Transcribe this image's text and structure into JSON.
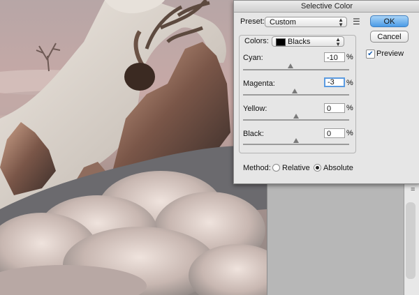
{
  "dialog": {
    "title": "Selective Color",
    "preset_label": "Preset:",
    "preset_value": "Custom",
    "preset_menu_icon": "list-menu-icon",
    "colors_label": "Colors:",
    "colors_value": "Blacks",
    "colors_swatch": "#000000",
    "ok_label": "OK",
    "cancel_label": "Cancel",
    "preview_label": "Preview",
    "preview_checked": true,
    "sliders": [
      {
        "label": "Cyan:",
        "value": "-10",
        "unit": "%",
        "level": -10
      },
      {
        "label": "Magenta:",
        "value": "-3",
        "unit": "%",
        "level": -3
      },
      {
        "label": "Yellow:",
        "value": "0",
        "unit": "%",
        "level": 0
      },
      {
        "label": "Black:",
        "value": "0",
        "unit": "%",
        "level": 0
      }
    ],
    "method_label": "Method:",
    "method_options": [
      {
        "label": "Relative",
        "selected": false
      },
      {
        "label": "Absolute",
        "selected": true
      }
    ]
  },
  "workspace": {
    "scroll_label": "="
  },
  "colors": {
    "accent": "#4b9be6",
    "dialog_bg": "#e6e6e6"
  }
}
